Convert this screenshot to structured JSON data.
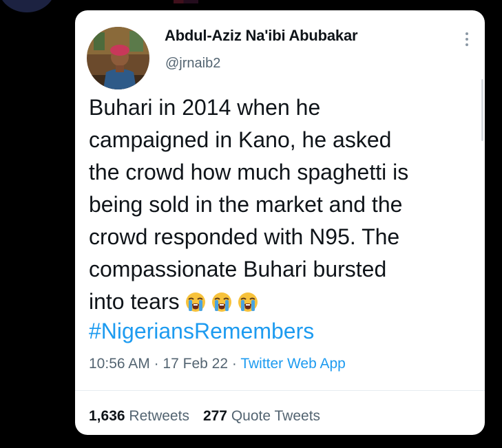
{
  "tweet": {
    "author_name": "Abdul-Aziz Na'ibi Abubakar",
    "author_handle": "@jrnaib2",
    "text_line1": "Buhari in 2014 when he",
    "text_line2": "campaigned in Kano, he asked",
    "text_line3": "the crowd how much spaghetti is",
    "text_line4": "being sold in the market and the",
    "text_line5": "crowd responded with N95. The",
    "text_line6": "compassionate Buhari bursted",
    "text_line7": "into tears",
    "emojis": [
      "loudly-crying-face",
      "loudly-crying-face",
      "loudly-crying-face"
    ],
    "hashtag": "#NigeriansRemembers",
    "time": "10:56 AM",
    "separator": "·",
    "date": "17 Feb 22",
    "source": "Twitter Web App",
    "retweets_count": "1,636",
    "retweets_label": "Retweets",
    "quote_count": "277",
    "quote_label": "Quote Tweets"
  },
  "colors": {
    "background": "#000000",
    "card": "#ffffff",
    "text": "#0f1419",
    "secondary": "#536471",
    "link": "#1d9bf0"
  }
}
